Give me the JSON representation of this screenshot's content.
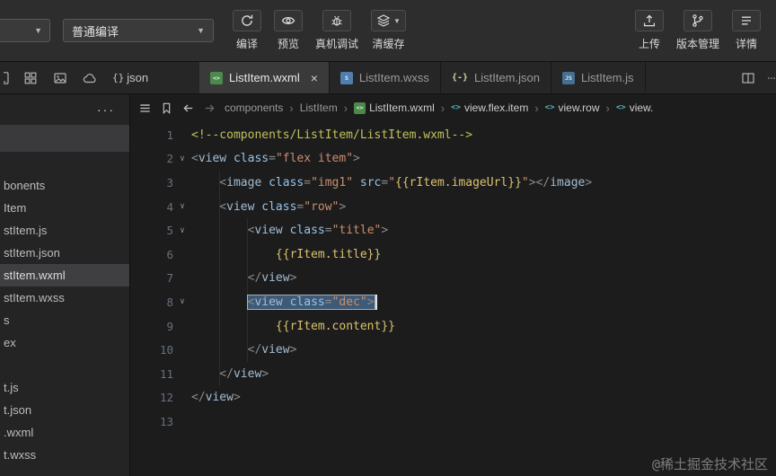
{
  "toolbar": {
    "compile_mode": "普通编译",
    "left_buttons": [
      {
        "name": "compile",
        "icon": "compile-icon",
        "label": "编译"
      },
      {
        "name": "preview",
        "icon": "preview-icon",
        "label": "预览"
      },
      {
        "name": "device-debug",
        "icon": "bug-icon",
        "label": "真机调试"
      },
      {
        "name": "clear-cache",
        "icon": "layers-icon",
        "label": "清缓存",
        "caret": true
      }
    ],
    "right_buttons": [
      {
        "name": "upload",
        "icon": "upload-icon",
        "label": "上传"
      },
      {
        "name": "version-control",
        "icon": "branch-icon",
        "label": "版本管理"
      },
      {
        "name": "details",
        "icon": "details-icon",
        "label": "详情"
      }
    ]
  },
  "tabbar": {
    "left_icons": [
      {
        "name": "device-panel-icon",
        "icon": "phone-icon",
        "clipped": true
      },
      {
        "name": "layout-grid-icon",
        "icon": "grid-icon"
      },
      {
        "name": "image-panel-icon",
        "icon": "image-icon"
      },
      {
        "name": "cloud-icon",
        "icon": "cloud-icon"
      }
    ],
    "json_badge": {
      "braces": "{}",
      "label": "json"
    },
    "file_icons": {
      "wxml": "<>",
      "wxss": "S",
      "json": "{-}",
      "js": "JS"
    },
    "tabs": [
      {
        "label": "ListItem.wxml",
        "type": "wxml",
        "active": true,
        "close": "×"
      },
      {
        "label": "ListItem.wxss",
        "type": "wxss",
        "active": false
      },
      {
        "label": "ListItem.json",
        "type": "json",
        "active": false
      },
      {
        "label": "ListItem.js",
        "type": "js",
        "active": false
      }
    ]
  },
  "sidebar": {
    "more_label": "···",
    "items": [
      {
        "type": "band"
      },
      {
        "type": "spacer"
      },
      {
        "label": "bonents"
      },
      {
        "label": "Item"
      },
      {
        "label": "stItem.js"
      },
      {
        "label": "stItem.json"
      },
      {
        "label": "stItem.wxml",
        "active": true
      },
      {
        "label": "stItem.wxss"
      },
      {
        "label": "s"
      },
      {
        "label": "ex"
      },
      {
        "type": "spacer"
      },
      {
        "label": "t.js"
      },
      {
        "label": "t.json"
      },
      {
        "label": ".wxml"
      },
      {
        "label": "t.wxss"
      }
    ]
  },
  "breadcrumb": {
    "element_glyph": "<>",
    "items": [
      {
        "label": "components"
      },
      {
        "label": "ListItem"
      },
      {
        "label": "ListItem.wxml",
        "icon": "wxml",
        "bright": true
      },
      {
        "label": "view.flex.item",
        "icon": "element",
        "bright": true
      },
      {
        "label": "view.row",
        "icon": "element",
        "bright": true
      },
      {
        "label": "view.",
        "icon": "element",
        "bright": true
      }
    ]
  },
  "editor": {
    "lines": [
      {
        "n": 1,
        "tk": [
          {
            "t": "<!--components/ListItem/ListItem.wxml-->",
            "c": "cm"
          }
        ]
      },
      {
        "n": 2,
        "fold": true,
        "tk": [
          {
            "t": "<",
            "c": "p"
          },
          {
            "t": "view",
            "c": "tag"
          },
          {
            "t": " ",
            "c": "p"
          },
          {
            "t": "class",
            "c": "attr"
          },
          {
            "t": "=",
            "c": "p"
          },
          {
            "t": "\"flex item\"",
            "c": "str"
          },
          {
            "t": ">",
            "c": "p"
          }
        ]
      },
      {
        "n": 3,
        "tk": [
          {
            "t": "    <",
            "c": "p"
          },
          {
            "t": "image",
            "c": "tag"
          },
          {
            "t": " ",
            "c": "p"
          },
          {
            "t": "class",
            "c": "attr"
          },
          {
            "t": "=",
            "c": "p"
          },
          {
            "t": "\"img1\"",
            "c": "str"
          },
          {
            "t": " ",
            "c": "p"
          },
          {
            "t": "src",
            "c": "attr"
          },
          {
            "t": "=",
            "c": "p"
          },
          {
            "t": "\"",
            "c": "str"
          },
          {
            "t": "{{rItem.imageUrl}}",
            "c": "mus"
          },
          {
            "t": "\"",
            "c": "str"
          },
          {
            "t": ">",
            "c": "p"
          },
          {
            "t": "</",
            "c": "p"
          },
          {
            "t": "image",
            "c": "tag"
          },
          {
            "t": ">",
            "c": "p"
          }
        ]
      },
      {
        "n": 4,
        "fold": true,
        "tk": [
          {
            "t": "    <",
            "c": "p"
          },
          {
            "t": "view",
            "c": "tag"
          },
          {
            "t": " ",
            "c": "p"
          },
          {
            "t": "class",
            "c": "attr"
          },
          {
            "t": "=",
            "c": "p"
          },
          {
            "t": "\"row\"",
            "c": "str"
          },
          {
            "t": ">",
            "c": "p"
          }
        ]
      },
      {
        "n": 5,
        "fold": true,
        "tk": [
          {
            "t": "        <",
            "c": "p"
          },
          {
            "t": "view",
            "c": "tag"
          },
          {
            "t": " ",
            "c": "p"
          },
          {
            "t": "class",
            "c": "attr"
          },
          {
            "t": "=",
            "c": "p"
          },
          {
            "t": "\"title\"",
            "c": "str"
          },
          {
            "t": ">",
            "c": "p"
          }
        ]
      },
      {
        "n": 6,
        "tk": [
          {
            "t": "            ",
            "c": "p"
          },
          {
            "t": "{{rItem.title}}",
            "c": "mus"
          }
        ]
      },
      {
        "n": 7,
        "tk": [
          {
            "t": "        </",
            "c": "p"
          },
          {
            "t": "view",
            "c": "tag"
          },
          {
            "t": ">",
            "c": "p"
          }
        ]
      },
      {
        "n": 8,
        "fold": true,
        "cursor": true,
        "tk": [
          {
            "t": "        ",
            "c": "p"
          },
          {
            "t": "<",
            "c": "p",
            "sel": true
          },
          {
            "t": "view",
            "c": "tag",
            "sel": true
          },
          {
            "t": " ",
            "c": "p",
            "sel": true
          },
          {
            "t": "class",
            "c": "attr",
            "sel": true
          },
          {
            "t": "=",
            "c": "p",
            "sel": true
          },
          {
            "t": "\"dec\"",
            "c": "str",
            "sel": true
          },
          {
            "t": ">",
            "c": "p",
            "sel": true
          }
        ]
      },
      {
        "n": 9,
        "tk": [
          {
            "t": "            ",
            "c": "p"
          },
          {
            "t": "{{rItem.content}}",
            "c": "mus"
          }
        ]
      },
      {
        "n": 10,
        "tk": [
          {
            "t": "        </",
            "c": "p"
          },
          {
            "t": "view",
            "c": "tag"
          },
          {
            "t": ">",
            "c": "p"
          }
        ]
      },
      {
        "n": 11,
        "tk": [
          {
            "t": "    </",
            "c": "p"
          },
          {
            "t": "view",
            "c": "tag"
          },
          {
            "t": ">",
            "c": "p"
          }
        ]
      },
      {
        "n": 12,
        "tk": [
          {
            "t": "</",
            "c": "p"
          },
          {
            "t": "view",
            "c": "tag"
          },
          {
            "t": ">",
            "c": "p"
          }
        ]
      },
      {
        "n": 13,
        "tk": []
      }
    ]
  },
  "watermark": "@稀土掘金技术社区",
  "colors": {
    "wxml_icon": "#4c8a4c",
    "wxss_icon": "#4f7fae",
    "selection": "#3e5a77",
    "accent_element": "#56b6c2"
  }
}
